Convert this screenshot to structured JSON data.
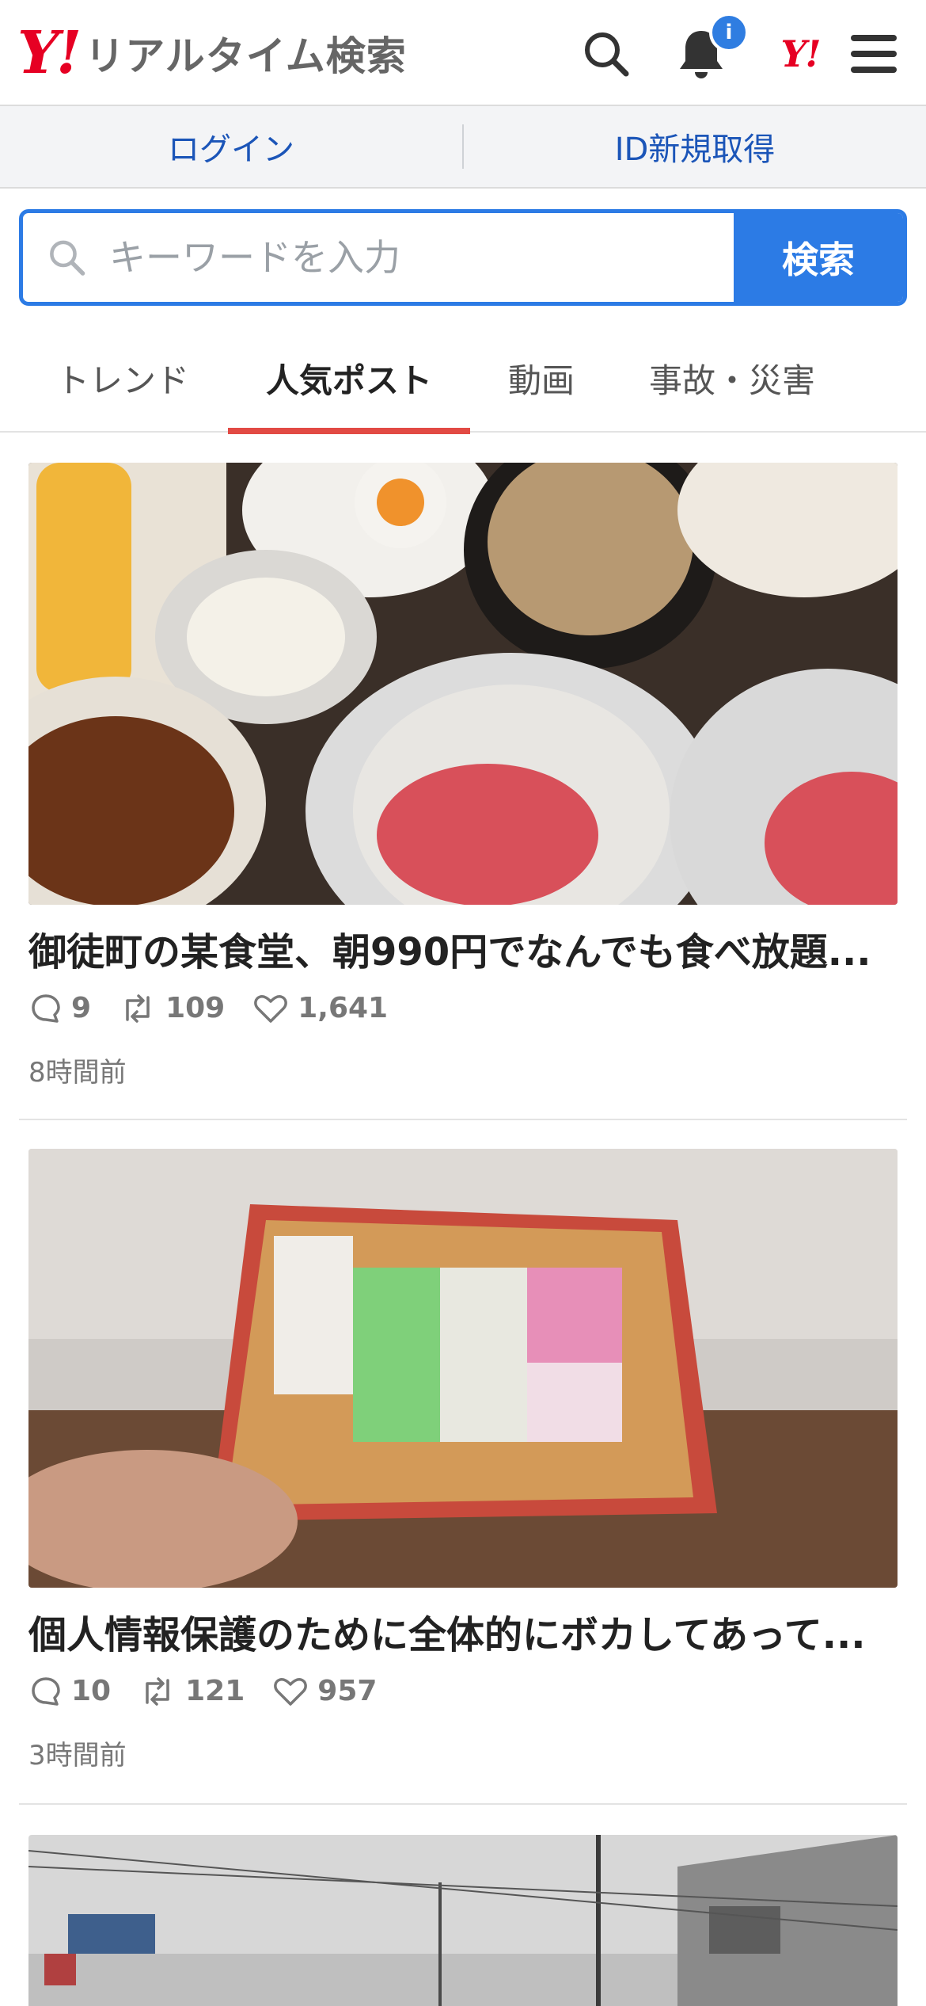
{
  "header": {
    "logo_mark": "Y!",
    "logo_title": "リアルタイム検索",
    "notification_badge": "i",
    "yahoo_link": "Y!",
    "brand_color": "#e60023"
  },
  "login_bar": {
    "login_label": "ログイン",
    "register_label": "ID新規取得",
    "link_color": "#1b55b8"
  },
  "search": {
    "placeholder": "キーワードを入力",
    "value": "",
    "button_label": "検索",
    "accent_color": "#2c7be5"
  },
  "tabs": [
    {
      "label": "トレンド",
      "active": false
    },
    {
      "label": "人気ポスト",
      "active": true
    },
    {
      "label": "動画",
      "active": false
    },
    {
      "label": "事故・災害",
      "active": false
    }
  ],
  "posts": [
    {
      "title": "御徒町の某食堂、朝990円でなんでも食べ放題...",
      "replies": "9",
      "reposts": "109",
      "likes": "1,641",
      "time": "8時間前"
    },
    {
      "title": "個人情報保護のために全体的にボカしてあって...",
      "replies": "10",
      "reposts": "121",
      "likes": "957",
      "time": "3時間前"
    }
  ],
  "icons": [
    "search-icon",
    "bell-icon",
    "menu-icon",
    "reply-icon",
    "repost-icon",
    "like-icon"
  ]
}
